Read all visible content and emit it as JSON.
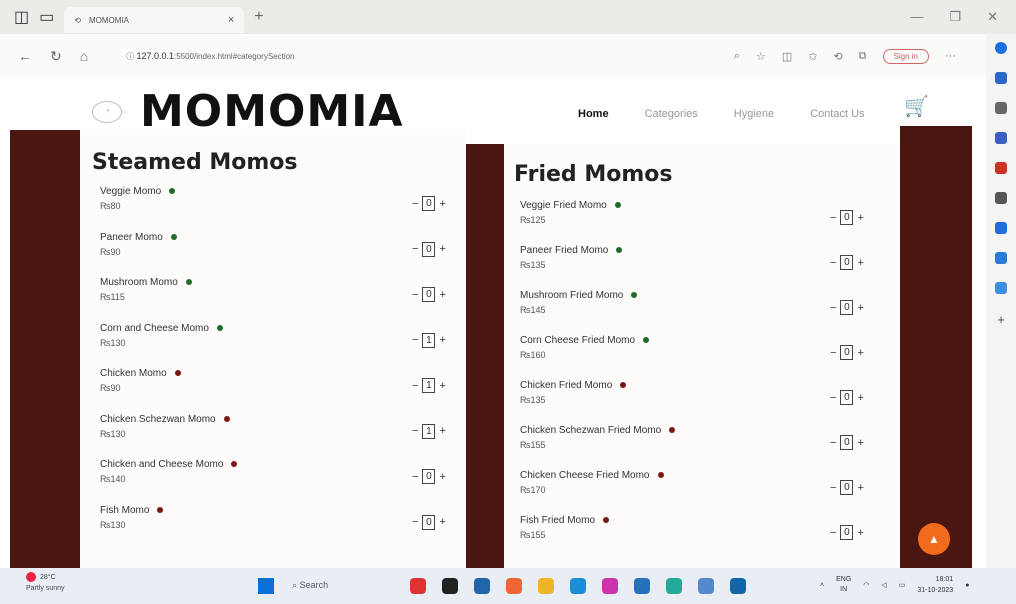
{
  "browser": {
    "tab_title": "MOMOMIA",
    "tab_close": "×",
    "new_tab": "+",
    "url_host": "127.0.0.1",
    "url_rest": ":5500/index.html#categorySection",
    "signin_label": "Sign in",
    "more": "···"
  },
  "site": {
    "brand": "MOMOMIA",
    "nav": [
      "Home",
      "Categories",
      "Hygiene",
      "Contact Us"
    ]
  },
  "steamed": {
    "title": "Steamed Momos",
    "items": [
      {
        "name": "Veggie Momo",
        "price": "₨80",
        "qty": "0",
        "type": "veg"
      },
      {
        "name": "Paneer Momo",
        "price": "₨90",
        "qty": "0",
        "type": "veg"
      },
      {
        "name": "Mushroom Momo",
        "price": "₨115",
        "qty": "0",
        "type": "veg"
      },
      {
        "name": "Corn and Cheese Momo",
        "price": "₨130",
        "qty": "1",
        "type": "veg"
      },
      {
        "name": "Chicken Momo",
        "price": "₨90",
        "qty": "1",
        "type": "nonveg"
      },
      {
        "name": "Chicken Schezwan Momo",
        "price": "₨130",
        "qty": "1",
        "type": "nonveg"
      },
      {
        "name": "Chicken and Cheese Momo",
        "price": "₨140",
        "qty": "0",
        "type": "nonveg"
      },
      {
        "name": "Fish Momo",
        "price": "₨130",
        "qty": "0",
        "type": "nonveg"
      }
    ]
  },
  "fried": {
    "title": "Fried Momos",
    "items": [
      {
        "name": "Veggie Fried Momo",
        "price": "₨125",
        "qty": "0",
        "type": "veg"
      },
      {
        "name": "Paneer Fried Momo",
        "price": "₨135",
        "qty": "0",
        "type": "veg"
      },
      {
        "name": "Mushroom Fried Momo",
        "price": "₨145",
        "qty": "0",
        "type": "veg"
      },
      {
        "name": "Corn Cheese Fried Momo",
        "price": "₨160",
        "qty": "0",
        "type": "veg"
      },
      {
        "name": "Chicken Fried Momo",
        "price": "₨135",
        "qty": "0",
        "type": "nonveg"
      },
      {
        "name": "Chicken Schezwan Fried Momo",
        "price": "₨155",
        "qty": "0",
        "type": "nonveg"
      },
      {
        "name": "Chicken Cheese Fried Momo",
        "price": "₨170",
        "qty": "0",
        "type": "nonveg"
      },
      {
        "name": "Fish Fried Momo",
        "price": "₨155",
        "qty": "0",
        "type": "nonveg"
      }
    ]
  },
  "controls": {
    "minus": "−",
    "plus": "+"
  },
  "colors": {
    "veg": "#1f6b2a",
    "nonveg": "#7a1818",
    "accent": "#f26b1d",
    "wall": "#4a1612"
  },
  "taskbar": {
    "temp": "28°C",
    "weather": "Partly sunny",
    "search": "Search",
    "lang": "ENG",
    "region": "IN",
    "time": "18:01",
    "date": "31-10-2023"
  }
}
